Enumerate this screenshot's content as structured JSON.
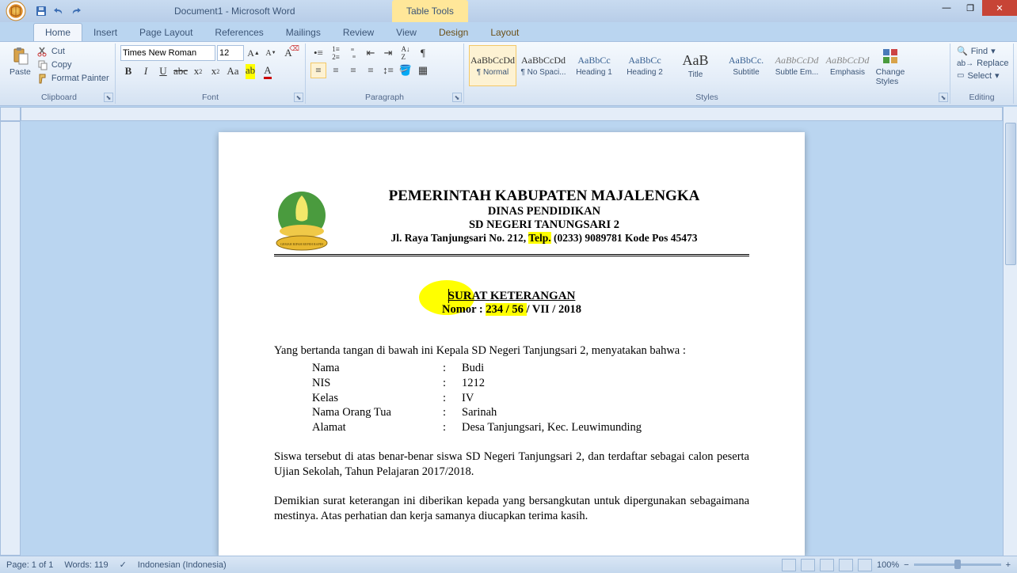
{
  "window": {
    "title": "Document1 - Microsoft Word",
    "table_tools": "Table Tools"
  },
  "tabs": {
    "home": "Home",
    "insert": "Insert",
    "page_layout": "Page Layout",
    "references": "References",
    "mailings": "Mailings",
    "review": "Review",
    "view": "View",
    "design": "Design",
    "layout": "Layout"
  },
  "clipboard": {
    "label": "Clipboard",
    "paste": "Paste",
    "cut": "Cut",
    "copy": "Copy",
    "format_painter": "Format Painter"
  },
  "font": {
    "label": "Font",
    "name": "Times New Roman",
    "size": "12"
  },
  "paragraph": {
    "label": "Paragraph"
  },
  "styles": {
    "label": "Styles",
    "items": [
      {
        "preview": "AaBbCcDd",
        "name": "¶ Normal",
        "cls": ""
      },
      {
        "preview": "AaBbCcDd",
        "name": "¶ No Spaci...",
        "cls": ""
      },
      {
        "preview": "AaBbCc",
        "name": "Heading 1",
        "cls": "hd"
      },
      {
        "preview": "AaBbCc",
        "name": "Heading 2",
        "cls": "hd"
      },
      {
        "preview": "AaB",
        "name": "Title",
        "cls": "ttl"
      },
      {
        "preview": "AaBbCc.",
        "name": "Subtitle",
        "cls": "hd"
      },
      {
        "preview": "AaBbCcDd",
        "name": "Subtle Em...",
        "cls": "em"
      },
      {
        "preview": "AaBbCcDd",
        "name": "Emphasis",
        "cls": "em"
      }
    ],
    "change": "Change Styles"
  },
  "editing": {
    "label": "Editing",
    "find": "Find",
    "replace": "Replace",
    "select": "Select"
  },
  "document": {
    "kop": {
      "l1": "PEMERINTAH KABUPATEN MAJALENGKA",
      "l2": "DINAS PENDIDIKAN",
      "l3": "SD NEGERI TANUNGSARI 2",
      "l4_a": "Jl. Raya Tanjungsari No. 212, ",
      "l4_b": "Telp.",
      "l4_c": " (0233) 9089781 Kode Pos 45473"
    },
    "judul": {
      "t1_a": "SURAT ",
      "t1_b": "KETERANGAN",
      "t2_a": "Nomor : ",
      "t2_b": "234 / 56 ",
      "t2_c": "/ VII / 2018"
    },
    "intro": "Yang bertanda tangan di bawah ini Kepala SD Negeri Tanjungsari 2, menyatakan bahwa :",
    "rows": [
      {
        "k": "Nama",
        "v": "Budi"
      },
      {
        "k": "NIS",
        "v": "1212"
      },
      {
        "k": "Kelas",
        "v": "IV"
      },
      {
        "k": "Nama Orang Tua",
        "v": "Sarinah"
      },
      {
        "k": "Alamat",
        "v": "Desa Tanjungsari, Kec. Leuwimunding"
      }
    ],
    "p2": "Siswa tersebut di atas benar-benar siswa SD Negeri Tanjungsari 2, dan terdaftar sebagai calon peserta Ujian Sekolah, Tahun Pelajaran 2017/2018.",
    "p3": "Demikian surat keterangan ini diberikan kepada yang bersangkutan untuk dipergunakan sebagaimana mestinya. Atas perhatian dan kerja samanya diucapkan terima kasih."
  },
  "status": {
    "page": "Page: 1 of 1",
    "words": "Words: 119",
    "lang": "Indonesian (Indonesia)",
    "zoom": "100%"
  }
}
